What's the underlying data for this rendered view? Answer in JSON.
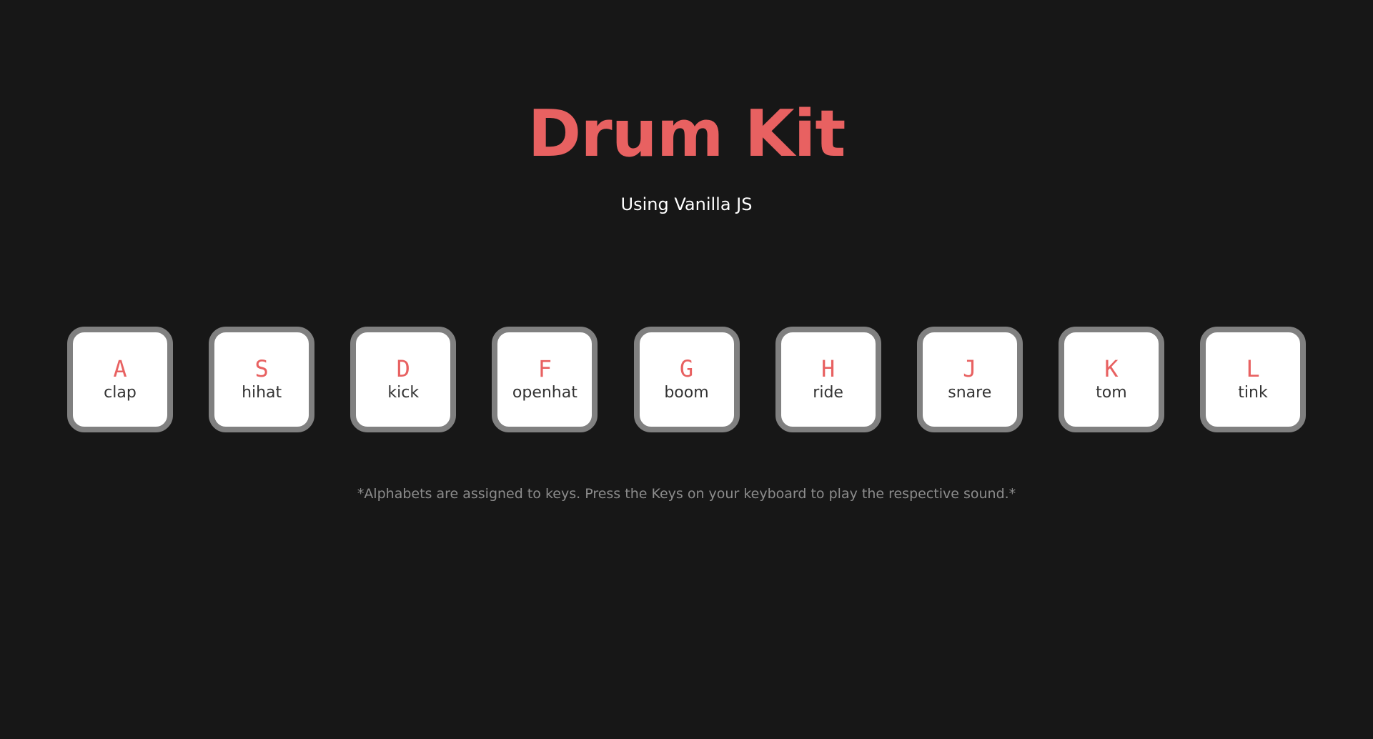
{
  "header": {
    "title": "Drum Kit",
    "subtitle": "Using Vanilla JS"
  },
  "keys": [
    {
      "letter": "A",
      "sound": "clap"
    },
    {
      "letter": "S",
      "sound": "hihat"
    },
    {
      "letter": "D",
      "sound": "kick"
    },
    {
      "letter": "F",
      "sound": "openhat"
    },
    {
      "letter": "G",
      "sound": "boom"
    },
    {
      "letter": "H",
      "sound": "ride"
    },
    {
      "letter": "J",
      "sound": "snare"
    },
    {
      "letter": "K",
      "sound": "tom"
    },
    {
      "letter": "L",
      "sound": "tink"
    }
  ],
  "footer": {
    "hint": "*Alphabets are assigned to keys. Press the Keys on your keyboard to play the respective sound.*"
  },
  "colors": {
    "background": "#171717",
    "accent": "#e86161",
    "key_border": "#808080",
    "key_background": "#ffffff",
    "hint_text": "#8c8c8c"
  }
}
